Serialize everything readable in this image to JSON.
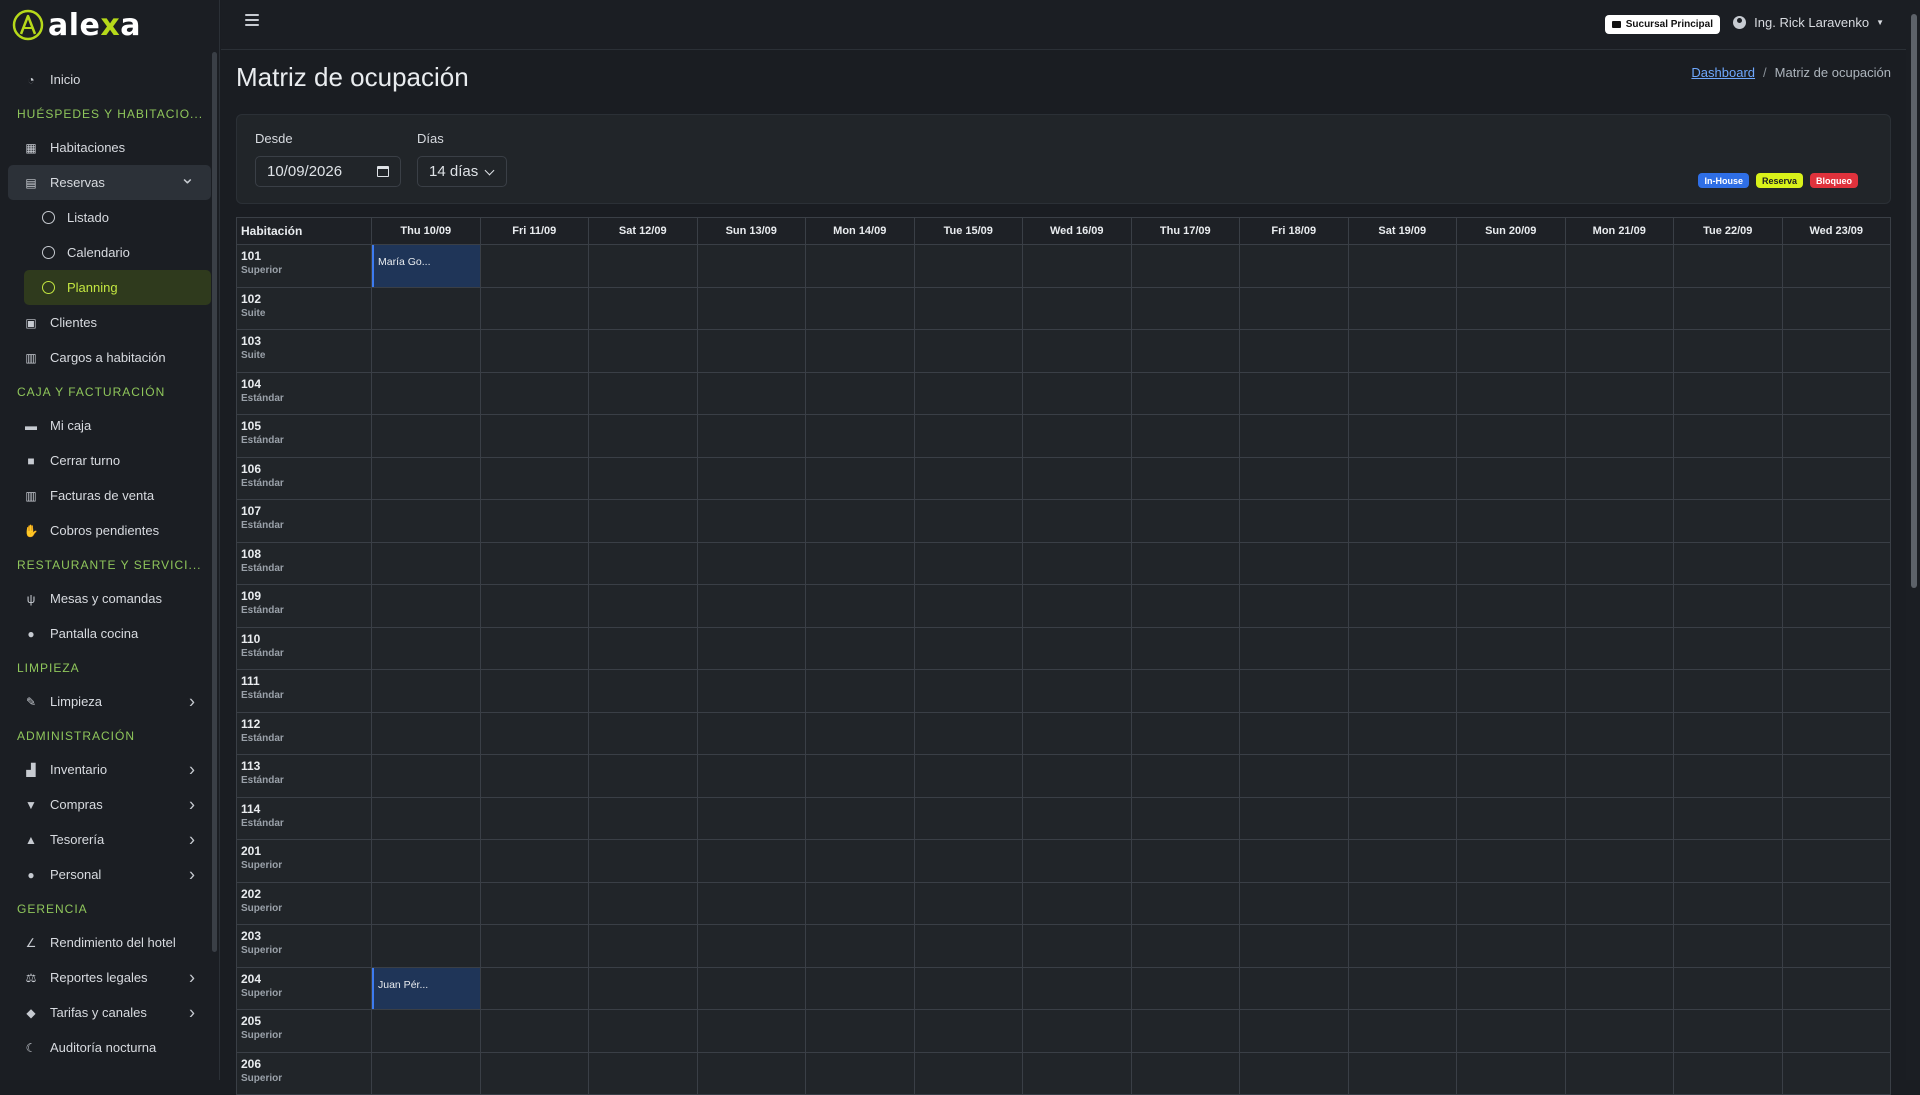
{
  "brand": {
    "name_prefix": "ale",
    "name_x": "x",
    "name_suffix": "a"
  },
  "sidebar": {
    "items": [
      {
        "type": "item",
        "label": "Inicio",
        "icon": "dashboard-icon"
      },
      {
        "type": "header",
        "label": "HUÉSPEDES Y HABITACIO..."
      },
      {
        "type": "item",
        "label": "Habitaciones",
        "icon": "grid-icon"
      },
      {
        "type": "item",
        "label": "Reservas",
        "icon": "calendar-icon",
        "expanded": true
      },
      {
        "type": "sub",
        "label": "Listado"
      },
      {
        "type": "sub",
        "label": "Calendario"
      },
      {
        "type": "sub",
        "label": "Planning",
        "active": true
      },
      {
        "type": "item",
        "label": "Clientes",
        "icon": "contact-icon"
      },
      {
        "type": "item",
        "label": "Cargos a habitación",
        "icon": "receipt-icon"
      },
      {
        "type": "header",
        "label": "CAJA Y FACTURACIÓN"
      },
      {
        "type": "item",
        "label": "Mi caja",
        "icon": "cash-register-icon"
      },
      {
        "type": "item",
        "label": "Cerrar turno",
        "icon": "lock-icon"
      },
      {
        "type": "item",
        "label": "Facturas de venta",
        "icon": "invoice-icon"
      },
      {
        "type": "item",
        "label": "Cobros pendientes",
        "icon": "hand-coin-icon"
      },
      {
        "type": "header",
        "label": "RESTAURANTE Y SERVICI..."
      },
      {
        "type": "item",
        "label": "Mesas y comandas",
        "icon": "utensils-icon"
      },
      {
        "type": "item",
        "label": "Pantalla cocina",
        "icon": "fire-icon"
      },
      {
        "type": "header",
        "label": "LIMPIEZA"
      },
      {
        "type": "item",
        "label": "Limpieza",
        "icon": "broom-icon",
        "chevron": true
      },
      {
        "type": "header",
        "label": "ADMINISTRACIÓN"
      },
      {
        "type": "item",
        "label": "Inventario",
        "icon": "boxes-icon",
        "chevron": true
      },
      {
        "type": "item",
        "label": "Compras",
        "icon": "cart-icon",
        "chevron": true
      },
      {
        "type": "item",
        "label": "Tesorería",
        "icon": "bank-icon",
        "chevron": true
      },
      {
        "type": "item",
        "label": "Personal",
        "icon": "users-icon",
        "chevron": true
      },
      {
        "type": "header",
        "label": "GERENCIA"
      },
      {
        "type": "item",
        "label": "Rendimiento del hotel",
        "icon": "chart-line-icon"
      },
      {
        "type": "item",
        "label": "Reportes legales",
        "icon": "scale-icon",
        "chevron": true
      },
      {
        "type": "item",
        "label": "Tarifas y canales",
        "icon": "tags-icon",
        "chevron": true
      },
      {
        "type": "item",
        "label": "Auditoría nocturna",
        "icon": "moon-icon"
      }
    ]
  },
  "topbar": {
    "branch": "Sucursal Principal",
    "user": "Ing. Rick Laravenko"
  },
  "page": {
    "title": "Matriz de ocupación"
  },
  "breadcrumb": {
    "home": "Dashboard",
    "current": "Matriz de ocupación"
  },
  "filters": {
    "from_label": "Desde",
    "from_value": "10/09/2026",
    "days_label": "Días",
    "days_value": "14 días"
  },
  "legend": [
    {
      "label": "In-House",
      "bg": "#2f6fe6",
      "fg": "#ffffff"
    },
    {
      "label": "Reserva",
      "bg": "#d9f21a",
      "fg": "#1a1d22"
    },
    {
      "label": "Bloqueo",
      "bg": "#e0323c",
      "fg": "#ffffff"
    }
  ],
  "grid": {
    "room_header": "Habitación",
    "days": [
      "Thu 10/09",
      "Fri 11/09",
      "Sat 12/09",
      "Sun 13/09",
      "Mon 14/09",
      "Tue 15/09",
      "Wed 16/09",
      "Thu 17/09",
      "Fri 18/09",
      "Sat 19/09",
      "Sun 20/09",
      "Mon 21/09",
      "Tue 22/09",
      "Wed 23/09"
    ],
    "rooms": [
      {
        "num": "101",
        "type": "Superior"
      },
      {
        "num": "102",
        "type": "Suite"
      },
      {
        "num": "103",
        "type": "Suite"
      },
      {
        "num": "104",
        "type": "Estándar"
      },
      {
        "num": "105",
        "type": "Estándar"
      },
      {
        "num": "106",
        "type": "Estándar"
      },
      {
        "num": "107",
        "type": "Estándar"
      },
      {
        "num": "108",
        "type": "Estándar"
      },
      {
        "num": "109",
        "type": "Estándar"
      },
      {
        "num": "110",
        "type": "Estándar"
      },
      {
        "num": "111",
        "type": "Estándar"
      },
      {
        "num": "112",
        "type": "Estándar"
      },
      {
        "num": "113",
        "type": "Estándar"
      },
      {
        "num": "114",
        "type": "Estándar"
      },
      {
        "num": "201",
        "type": "Superior"
      },
      {
        "num": "202",
        "type": "Superior"
      },
      {
        "num": "203",
        "type": "Superior"
      },
      {
        "num": "204",
        "type": "Superior"
      },
      {
        "num": "205",
        "type": "Superior"
      },
      {
        "num": "206",
        "type": "Superior"
      }
    ],
    "bookings": [
      {
        "room": "101",
        "day": 0,
        "guest": "María Go..."
      },
      {
        "room": "204",
        "day": 0,
        "guest": "Juan Pér..."
      }
    ]
  }
}
